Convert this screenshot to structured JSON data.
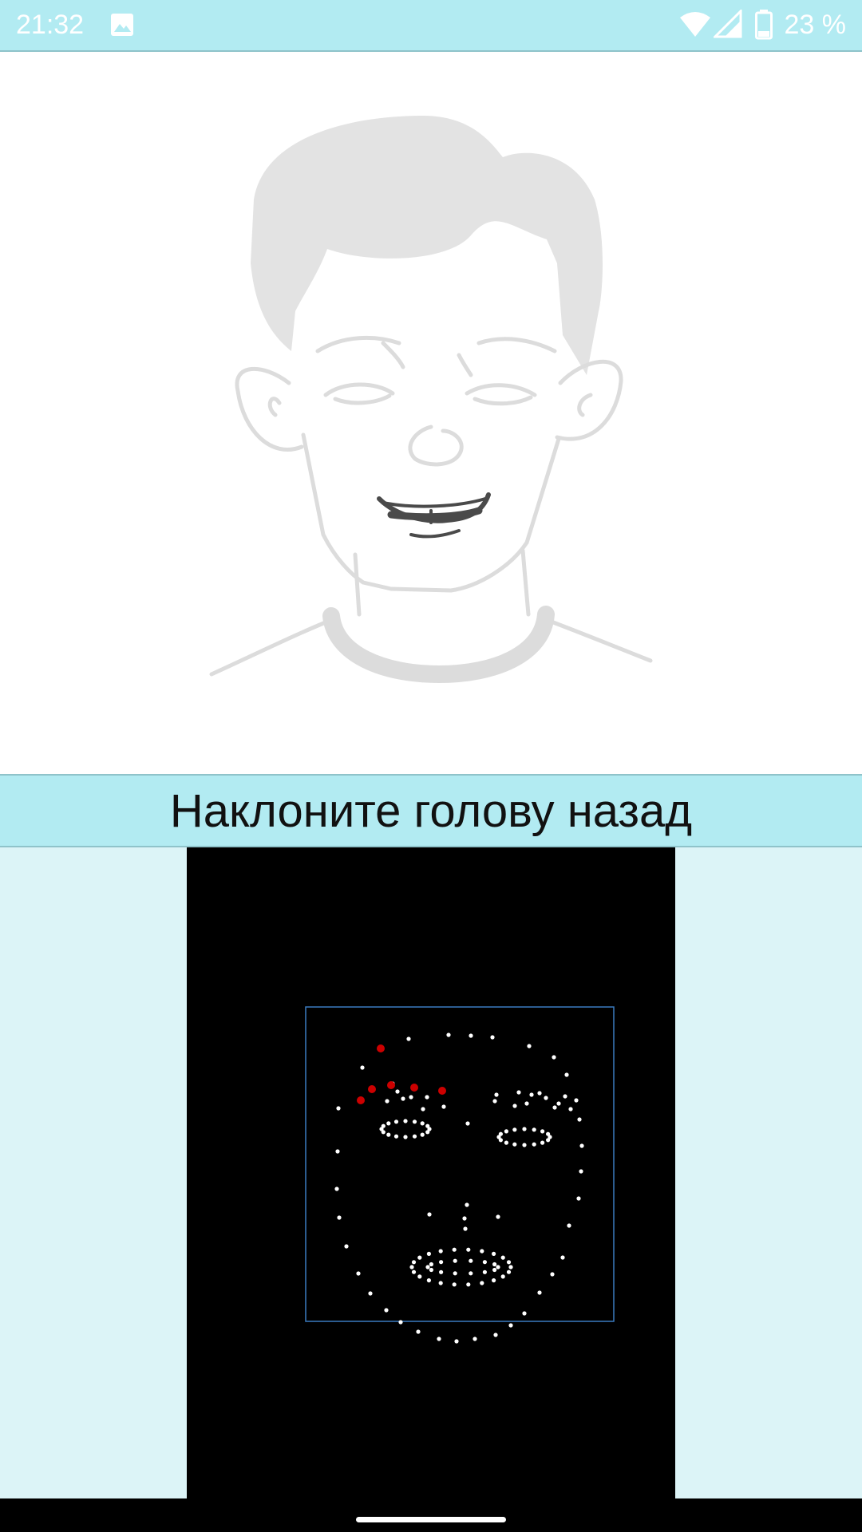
{
  "status_bar": {
    "time": "21:32",
    "battery_text": "23 %",
    "icons": [
      "image-icon",
      "wifi-icon",
      "signal-icon",
      "battery-icon"
    ]
  },
  "illustration": {
    "subject": "face-illustration",
    "colors": {
      "sketch": "#dcdcdc",
      "mouth": "#4a4a4a"
    }
  },
  "instruction": {
    "text": "Наклоните голову назад"
  },
  "camera": {
    "landmark_color": "#ffffff",
    "highlight_color": "#cc0000",
    "box_color": "#3a7bbf"
  },
  "colors": {
    "accent": "#b2ebf2",
    "panel": "#dcf4f7"
  }
}
